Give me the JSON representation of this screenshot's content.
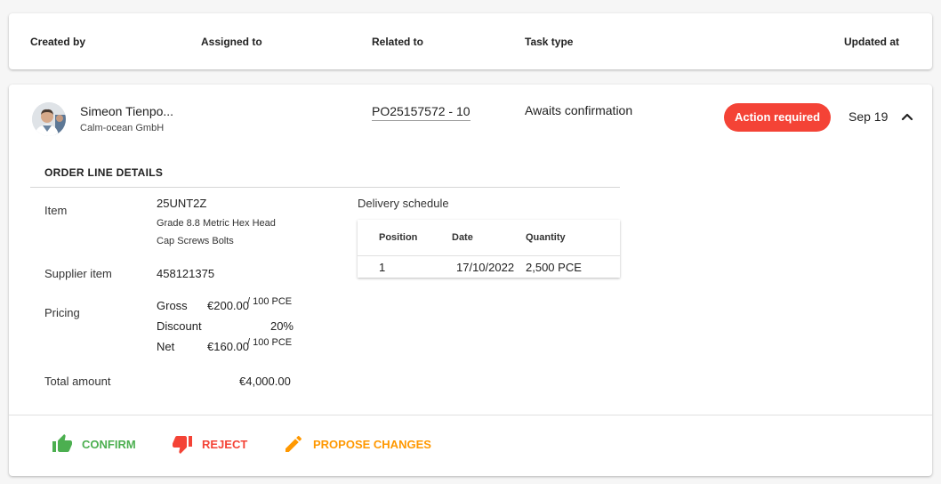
{
  "header": {
    "created_by": "Created by",
    "assigned_to": "Assigned to",
    "related_to": "Related to",
    "task_type": "Task type",
    "updated_at": "Updated at"
  },
  "task": {
    "person_name": "Simeon Tienpo...",
    "company": "Calm-ocean GmbH",
    "related": "PO25157572 - 10",
    "type": "Awaits confirmation",
    "badge": "Action required",
    "updated": "Sep 19"
  },
  "details": {
    "title": "ORDER LINE DETAILS",
    "item_label": "Item",
    "item_code": "25UNT2Z",
    "item_desc_1": "Grade 8.8 Metric Hex Head",
    "item_desc_2": "Cap Screws Bolts",
    "supplier_item_label": "Supplier item",
    "supplier_item": "458121375",
    "pricing_label": "Pricing",
    "gross_label": "Gross",
    "gross_value": "€200.00",
    "gross_unit": "/ 100 PCE",
    "discount_label": "Discount",
    "discount_value": "20%",
    "net_label": "Net",
    "net_value": "€160.00",
    "net_unit": "/ 100 PCE",
    "total_label": "Total amount",
    "total_value": "€4,000.00"
  },
  "schedule": {
    "title": "Delivery schedule",
    "columns": [
      "Position",
      "Date",
      "Quantity"
    ],
    "rows": [
      [
        "1",
        "17/10/2022",
        "2,500 PCE"
      ]
    ]
  },
  "actions": {
    "confirm": "CONFIRM",
    "reject": "REJECT",
    "propose": "PROPOSE CHANGES"
  },
  "colors": {
    "badge": "#f44336",
    "confirm": "#4caf50",
    "reject": "#f44336",
    "propose": "#ff9800"
  },
  "icons": {
    "chevron": "chevron-up-icon",
    "confirm": "thumb-up-icon",
    "reject": "thumb-down-icon",
    "propose": "pencil-icon"
  }
}
